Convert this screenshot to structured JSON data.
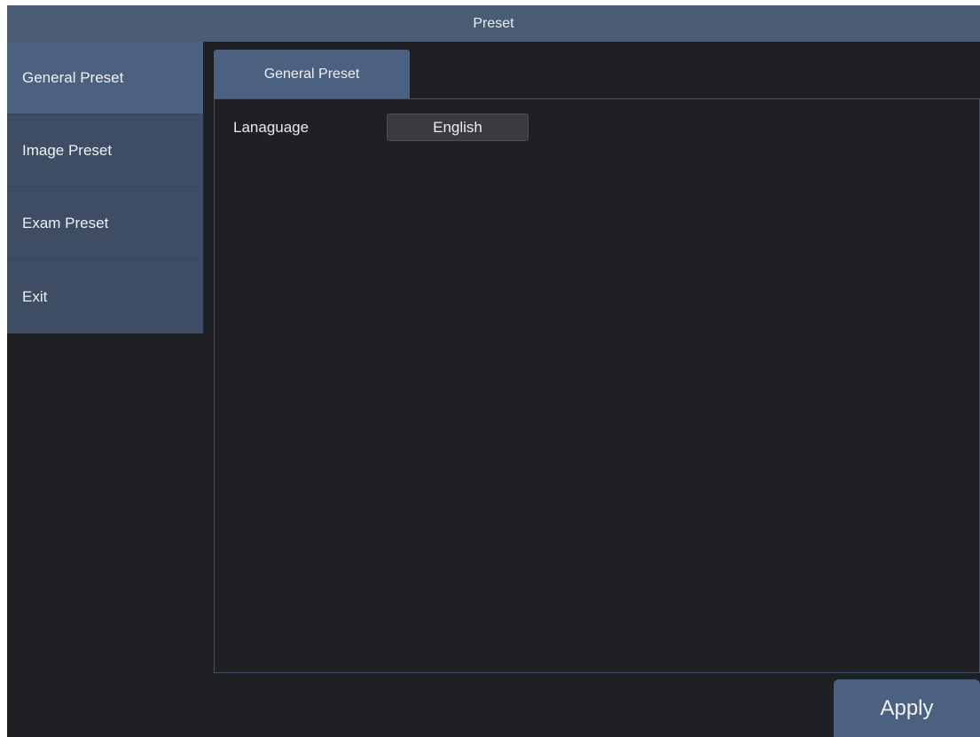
{
  "window": {
    "title": "Preset"
  },
  "sidebar": {
    "items": [
      {
        "label": "General Preset",
        "active": true
      },
      {
        "label": "Image Preset",
        "active": false
      },
      {
        "label": "Exam Preset",
        "active": false
      },
      {
        "label": "Exit",
        "active": false
      }
    ]
  },
  "tabs": [
    {
      "label": "General Preset",
      "active": true
    }
  ],
  "general": {
    "language_label": "Lanaguage",
    "language_value": "English"
  },
  "footer": {
    "apply_label": "Apply"
  },
  "colors": {
    "title_bar": "#4a5c74",
    "sidebar_active": "#4c6080",
    "sidebar_item": "#3e4d63",
    "background": "#1f2023",
    "panel_border": "#3f5368",
    "select_bg": "#3a3b3e"
  }
}
